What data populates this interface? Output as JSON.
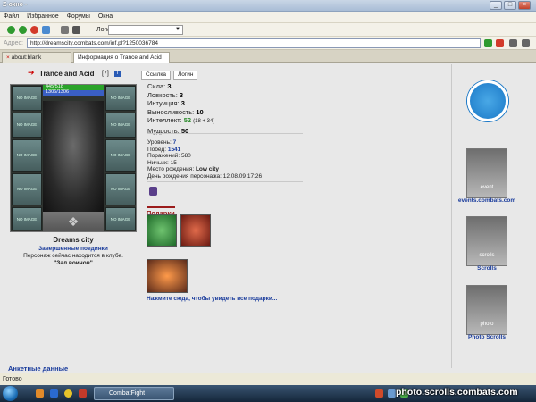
{
  "window": {
    "title": "Z-окно -"
  },
  "menu": {
    "items": [
      "Файл",
      "Избранное",
      "Форумы",
      "Окна"
    ]
  },
  "toolbar": {
    "login_label": "Логин:",
    "login_value": "▼"
  },
  "address": {
    "label": "Адрес:",
    "url": "http://dreamscity.combats.com/inf.pl?1250036784"
  },
  "tabs": [
    {
      "label": "about:blank"
    },
    {
      "label": "Информация о Trance and Acid"
    }
  ],
  "character": {
    "name": "Trance and Acid",
    "level": "[7]",
    "info_glyph": "i",
    "hp": "445/518",
    "mana": "1306/1306",
    "slot_label": "NO IMAGE",
    "city": "Dreams city",
    "finished_fights": "Завершенные поединки",
    "in_club": "Персонаж сейчас находится в клубе.",
    "hall": "\"Зал воинов\""
  },
  "buttons": {
    "link": "Ссылка",
    "login": "Логин"
  },
  "stats": [
    {
      "label": "Сила:",
      "value": "3",
      "extra": ""
    },
    {
      "label": "Ловкость:",
      "value": "3",
      "extra": ""
    },
    {
      "label": "Интуиция:",
      "value": "3",
      "extra": ""
    },
    {
      "label": "Выносливость:",
      "value": "10",
      "extra": ""
    },
    {
      "label": "Интеллект:",
      "value": "52",
      "extra": "(18 + 34)"
    },
    {
      "label": "Мудрость:",
      "value": "50",
      "extra": ""
    }
  ],
  "info": [
    {
      "label": "Уровень:",
      "value": "7"
    },
    {
      "label": "Побед:",
      "value": "1541"
    },
    {
      "label": "Поражений:",
      "value": "580"
    },
    {
      "label": "Ничьих:",
      "value": "15"
    },
    {
      "label": "Место рождения:",
      "value": "Low city"
    },
    {
      "label": "День рождения персонажа:",
      "value": "12.08.09 17:26"
    }
  ],
  "gifts": {
    "label": "Подарки",
    "link": "Нажмите сюда, чтобы увидеть все подарки..."
  },
  "anket": {
    "label": "Анкетные данные"
  },
  "right_links": [
    {
      "label": "events.combats.com",
      "icon_text": "event"
    },
    {
      "label": "Scrolls",
      "icon_text": "scrolls"
    },
    {
      "label": "Photo Scrolls",
      "icon_text": "photo"
    }
  ],
  "status": {
    "text": "Готово"
  },
  "taskbar": {
    "task": "CombatFight"
  },
  "watermark": "photo.scrolls.combats.com",
  "colors": {
    "accent": "#1a3c9c",
    "gifts": "#9b1b1b",
    "hp": "#2aa32a",
    "mana": "#3a5fc4"
  }
}
